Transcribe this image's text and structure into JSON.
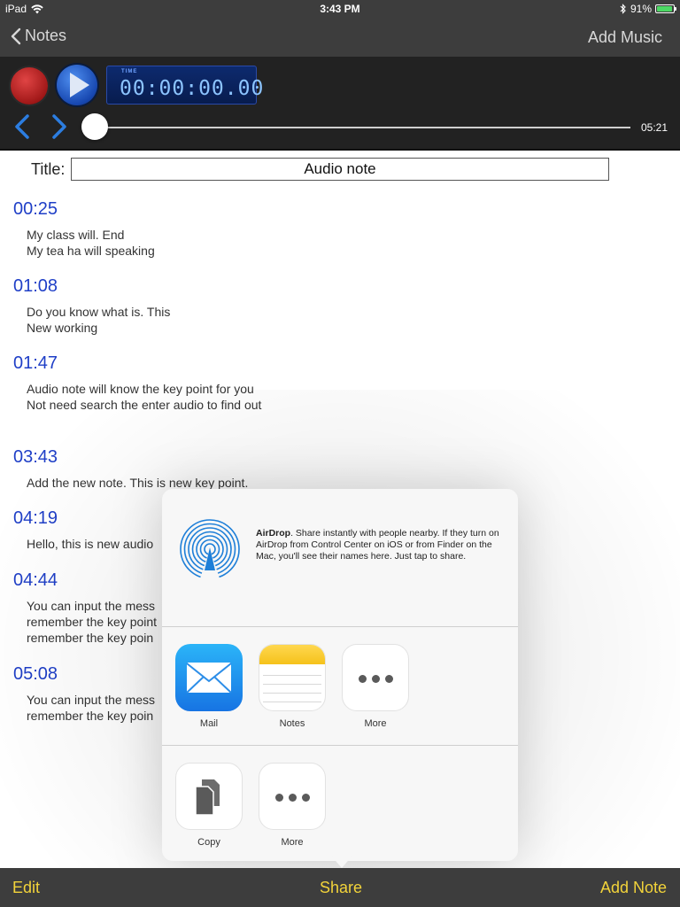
{
  "status_bar": {
    "device": "iPad",
    "time": "3:43 PM",
    "battery": "91%"
  },
  "nav": {
    "back_label": "Notes",
    "right_label": "Add Music"
  },
  "recorder": {
    "timer_label": "TIME",
    "timer_value": "00:00:00.00",
    "duration": "05:21",
    "progress": 0.0
  },
  "title": {
    "label": "Title:",
    "value": "Audio note"
  },
  "notes": [
    {
      "time": "00:25",
      "lines": [
        "My class will. End",
        "My tea ha will speaking"
      ]
    },
    {
      "time": "01:08",
      "lines": [
        "Do you know what is. This",
        "New working"
      ]
    },
    {
      "time": "01:47",
      "lines": [
        "Audio note will know the key point for you",
        "Not need search the enter audio to find out"
      ]
    },
    {
      "time": "03:43",
      "lines": [
        "Add the new note. This is new key point."
      ]
    },
    {
      "time": "04:19",
      "lines": [
        "Hello,  this is new audio"
      ]
    },
    {
      "time": "04:44",
      "lines": [
        "You can input the mess",
        "remember the key point",
        "remember the key poin"
      ]
    },
    {
      "time": "05:08",
      "lines": [
        "You can input the mess",
        "remember the key poin"
      ]
    }
  ],
  "share_sheet": {
    "airdrop_title": "AirDrop",
    "airdrop_text": ". Share instantly with people nearby. If they turn on AirDrop from Control Center on iOS or from Finder on the Mac, you'll see their names here. Just tap to share.",
    "apps": [
      {
        "label": "Mail",
        "icon": "mail-icon"
      },
      {
        "label": "Notes",
        "icon": "notes-icon"
      },
      {
        "label": "More",
        "icon": "more-icon"
      }
    ],
    "actions": [
      {
        "label": "Copy",
        "icon": "copy-icon"
      },
      {
        "label": "More",
        "icon": "more-icon"
      }
    ]
  },
  "toolbar": {
    "edit": "Edit",
    "share": "Share",
    "add_note": "Add Note"
  },
  "colors": {
    "toolbar_text": "#f2d33a",
    "timestamp": "#1f3fc7",
    "bar_bg": "#3d3d3d"
  }
}
